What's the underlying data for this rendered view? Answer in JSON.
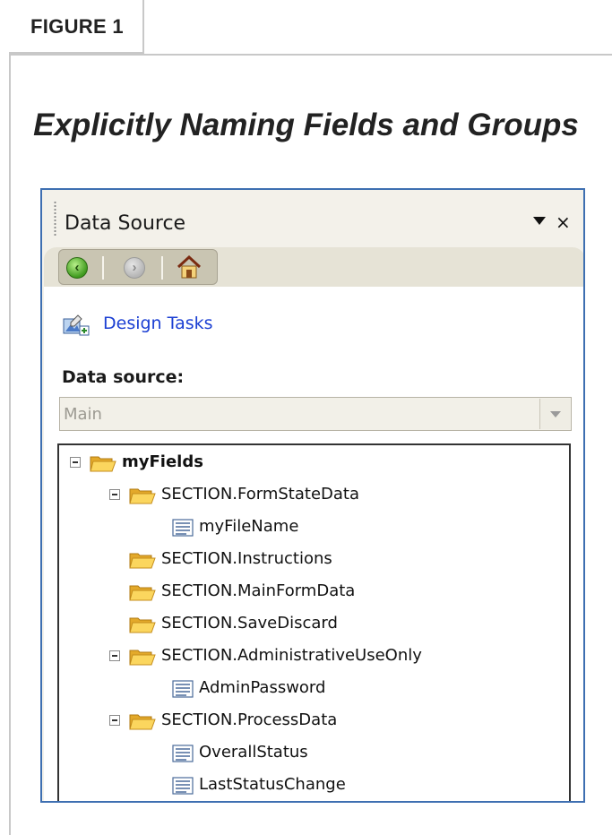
{
  "figure": {
    "tab_label": "FIGURE 1",
    "title": "Explicitly Naming Fields and Groups"
  },
  "panel": {
    "title": "Data Source",
    "menu_icon": "menu-dropdown-arrow",
    "close_icon": "close-x",
    "toolbar": {
      "back": "back-icon",
      "forward": "forward-icon",
      "home": "home-icon"
    },
    "design_tasks": "Design Tasks",
    "data_source_label": "Data source:",
    "data_source_value": "Main"
  },
  "tree": {
    "root": "myFields",
    "formstate": "SECTION.FormStateData",
    "filename": "myFileName",
    "instructions": "SECTION.Instructions",
    "mainform": "SECTION.MainFormData",
    "savediscard": "SECTION.SaveDiscard",
    "admin": "SECTION.AdministrativeUseOnly",
    "adminpassword": "AdminPassword",
    "process": "SECTION.ProcessData",
    "overall": "OverallStatus",
    "laststatus": "LastStatusChange"
  },
  "colors": {
    "accent_blue": "#3e6fb1",
    "link_blue": "#1b3fd3",
    "folder_yellow": "#f4c94a"
  }
}
